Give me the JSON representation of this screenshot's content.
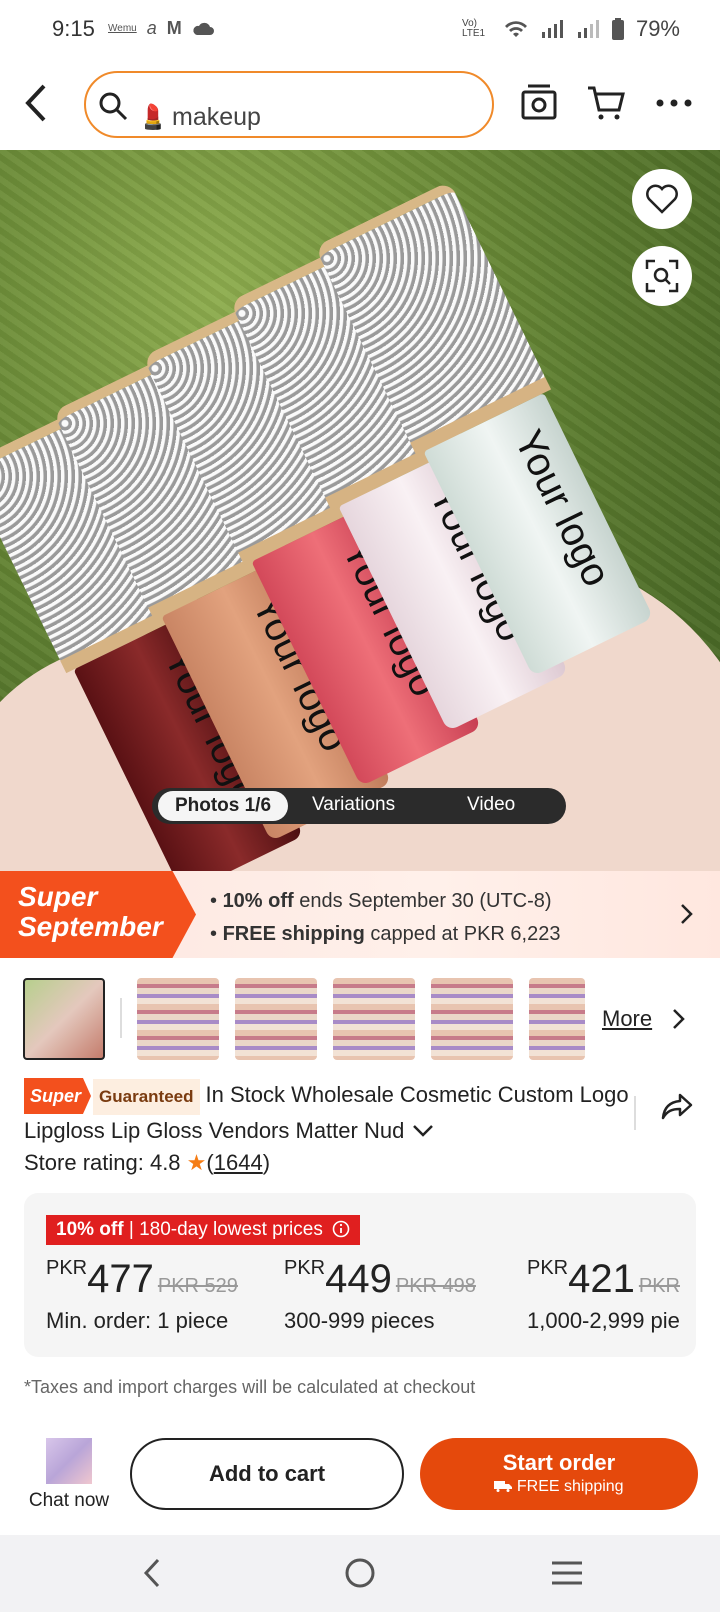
{
  "status_bar": {
    "time": "9:15",
    "notif_icons": [
      "wemu-icon",
      "alibaba-icon",
      "gmail-icon",
      "cloud-icon"
    ],
    "signal_text": "Vo) LTE1",
    "battery": "79%"
  },
  "header": {
    "search_emoji": "💄",
    "search_text": "makeup"
  },
  "hero": {
    "logo_text": "Your logo",
    "tabs": [
      "Photos 1/6",
      "Variations",
      "Video"
    ]
  },
  "promo": {
    "badge_line1": "Super",
    "badge_line2": "September",
    "line1_bold": "10% off",
    "line1_rest": " ends September 30 (UTC-8)",
    "line2_bold": "FREE shipping",
    "line2_rest": " capped at PKR 6,223"
  },
  "thumbnails": {
    "more_label": "More"
  },
  "product": {
    "super_badge": "Super",
    "guaranteed_badge": "Guaranteed",
    "title": "In Stock Wholesale  Cosmetic Custom Logo Lipgloss Lip Gloss Vendors Matter Nud",
    "rating_label": "Store rating: 4.8",
    "rating_count": "1644"
  },
  "pricing": {
    "tag_left": "10% off",
    "tag_right": "180-day lowest prices",
    "tiers": [
      {
        "currency": "PKR",
        "price": "477",
        "old": "PKR 529",
        "qty": "Min. order: 1 piece"
      },
      {
        "currency": "PKR",
        "price": "449",
        "old": "PKR 498",
        "qty": "300-999 pieces"
      },
      {
        "currency": "PKR",
        "price": "421",
        "old": "PKR",
        "qty": "1,000-2,999 pie"
      }
    ]
  },
  "tax_note": "*Taxes and import charges will be calculated at checkout",
  "actions": {
    "chat": "Chat now",
    "add_to_cart": "Add to cart",
    "start_order": "Start order",
    "free_shipping": "FREE shipping"
  },
  "colors": {
    "accent": "#e5490c",
    "promo_red": "#f3501d",
    "price_tag_red": "#e01f1f",
    "search_border": "#f08a2a"
  }
}
